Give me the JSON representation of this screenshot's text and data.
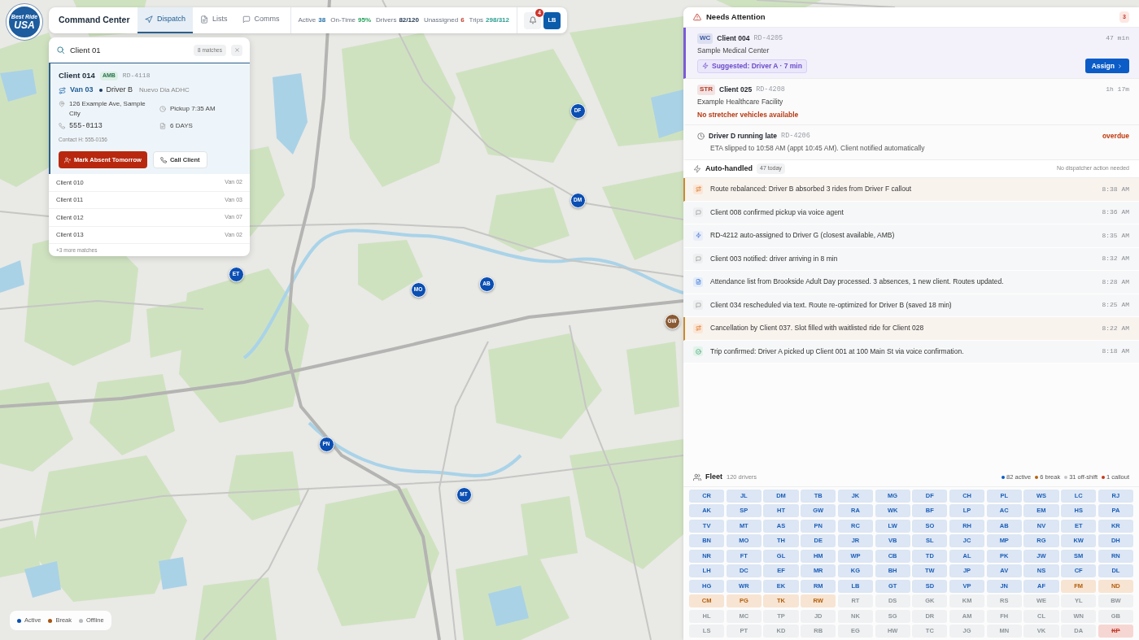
{
  "logo": {
    "line_1": "Best Ride",
    "line_2": "USA"
  },
  "header": {
    "title": "Command Center",
    "tabs": [
      {
        "label": "Dispatch",
        "kind": "navigation",
        "selected": true
      },
      {
        "label": "Lists",
        "kind": "document",
        "selected": false
      },
      {
        "label": "Comms",
        "kind": "chat",
        "selected": false
      }
    ],
    "stats": [
      {
        "label": "Active",
        "value": "38",
        "kind": "info"
      },
      {
        "label": "On-Time",
        "value": "95%",
        "kind": "good"
      },
      {
        "label": "Drivers",
        "value": "82/120",
        "kind": "neutral"
      },
      {
        "label": "Unassigned",
        "value": "6",
        "kind": "alert"
      },
      {
        "label": "Trips",
        "value": "298/312",
        "kind": "progress"
      }
    ],
    "notifications": {
      "count": "4"
    },
    "user": {
      "initials": "LB"
    }
  },
  "search": {
    "value": "Client 01",
    "match_count": "8 matches",
    "selected_result": {
      "client": "Client 014",
      "tag": "AMB",
      "ride_id": "RD-4118",
      "vehicle": "Van 03",
      "driver": "Driver B",
      "program": "Nuevo Dia ADHC",
      "address": "126 Example Ave, Sample City",
      "pickup": "Pickup 7:35 AM",
      "phone": "555-0113",
      "schedule": "6 DAYS",
      "contact": "Contact H: 555-0156",
      "actions": [
        {
          "label": "Mark Absent Tomorrow",
          "kind": "danger"
        },
        {
          "label": "Call Client",
          "kind": "call"
        }
      ]
    },
    "results": [
      {
        "client": "Client 010",
        "vehicle": "Van 02"
      },
      {
        "client": "Client 011",
        "vehicle": "Van 03"
      },
      {
        "client": "Client 012",
        "vehicle": "Van 07"
      },
      {
        "client": "Client 013",
        "vehicle": "Van 02"
      }
    ],
    "more": "+3 more matches"
  },
  "map": {
    "markers": [
      {
        "initials": "DF",
        "kind": "active"
      },
      {
        "initials": "DM",
        "kind": "active"
      },
      {
        "initials": "ET",
        "kind": "active"
      },
      {
        "initials": "AB",
        "kind": "active"
      },
      {
        "initials": "MO",
        "kind": "active"
      },
      {
        "initials": "GW",
        "kind": "break"
      },
      {
        "initials": "PN",
        "kind": "active"
      },
      {
        "initials": "MT",
        "kind": "active"
      }
    ],
    "legend": [
      {
        "label": "Active",
        "color": "#0b4fb3"
      },
      {
        "label": "Break",
        "color": "#a9530f"
      },
      {
        "label": "Offline",
        "color": "#b9bcbf"
      }
    ]
  },
  "needs_attention": {
    "title": "Needs Attention",
    "count": "3",
    "items": [
      {
        "kind": "ride",
        "selected": true,
        "tag": "WC",
        "color": "#3a57a0",
        "client": "Client 004",
        "ride_id": "RD-4205",
        "age": "47 min",
        "facility": "Sample Medical Center",
        "suggestion": "Suggested: Driver A · 7 min",
        "action": "Assign"
      },
      {
        "kind": "ride",
        "selected": false,
        "tag": "STR",
        "color": "#b53a2a",
        "client": "Client 025",
        "ride_id": "RD-4208",
        "age": "1h 17m",
        "facility": "Example Healthcare Facility",
        "warning": "No stretcher vehicles available"
      },
      {
        "kind": "late",
        "selected": false,
        "title": "Driver D running late",
        "ride_id": "RD-4206",
        "status": "overdue",
        "detail": "ETA slipped to 10:58 AM (appt 10:45 AM). Client notified automatically"
      }
    ]
  },
  "auto_handled": {
    "title": "Auto-handled",
    "count": "47 today",
    "note": "No dispatcher action needed",
    "events": [
      {
        "kind": "rebalance",
        "text": "Route rebalanced: Driver B absorbed 3 rides from Driver F callout",
        "time": "8:38 AM"
      },
      {
        "kind": "message",
        "text": "Client 008 confirmed pickup via voice agent",
        "time": "8:36 AM"
      },
      {
        "kind": "auto_assign",
        "text": "RD-4212 auto-assigned to Driver G (closest available, AMB)",
        "time": "8:35 AM"
      },
      {
        "kind": "message",
        "text": "Client 003 notified: driver arriving in 8 min",
        "time": "8:32 AM"
      },
      {
        "kind": "document",
        "text": "Attendance list from Brookside Adult Day processed. 3 absences, 1 new client. Routes updated.",
        "time": "8:28 AM"
      },
      {
        "kind": "message",
        "text": "Client 034 rescheduled via text. Route re-optimized for Driver B (saved 18 min)",
        "time": "8:25 AM"
      },
      {
        "kind": "rebalance",
        "text": "Cancellation by Client 037. Slot filled with waitlisted ride for Client 028",
        "time": "8:22 AM"
      },
      {
        "kind": "confirmed",
        "text": "Trip confirmed: Driver A picked up Client 001 at 100 Main St via voice confirmation.",
        "time": "8:18 AM"
      }
    ]
  },
  "fleet": {
    "title": "Fleet",
    "count": "120 drivers",
    "summary": [
      {
        "label": "82 active",
        "color": "#0b5cc7"
      },
      {
        "label": "6 break",
        "color": "#b8600f"
      },
      {
        "label": "31 off-shift",
        "color": "#c2c5c8"
      },
      {
        "label": "1 callout",
        "color": "#c43a1c"
      }
    ],
    "drivers": [
      {
        "initials": "CR",
        "kind": "active"
      },
      {
        "initials": "JL",
        "kind": "active"
      },
      {
        "initials": "DM",
        "kind": "active"
      },
      {
        "initials": "TB",
        "kind": "active"
      },
      {
        "initials": "JK",
        "kind": "active"
      },
      {
        "initials": "MG",
        "kind": "active"
      },
      {
        "initials": "DF",
        "kind": "active"
      },
      {
        "initials": "CH",
        "kind": "active"
      },
      {
        "initials": "PL",
        "kind": "active"
      },
      {
        "initials": "WS",
        "kind": "active"
      },
      {
        "initials": "LC",
        "kind": "active"
      },
      {
        "initials": "RJ",
        "kind": "active"
      },
      {
        "initials": "AK",
        "kind": "active"
      },
      {
        "initials": "SP",
        "kind": "active"
      },
      {
        "initials": "HT",
        "kind": "active"
      },
      {
        "initials": "GW",
        "kind": "active"
      },
      {
        "initials": "RA",
        "kind": "active"
      },
      {
        "initials": "WK",
        "kind": "active"
      },
      {
        "initials": "BF",
        "kind": "active"
      },
      {
        "initials": "LP",
        "kind": "active"
      },
      {
        "initials": "AC",
        "kind": "active"
      },
      {
        "initials": "EM",
        "kind": "active"
      },
      {
        "initials": "HS",
        "kind": "active"
      },
      {
        "initials": "PA",
        "kind": "active"
      },
      {
        "initials": "TV",
        "kind": "active"
      },
      {
        "initials": "MT",
        "kind": "active"
      },
      {
        "initials": "AS",
        "kind": "active"
      },
      {
        "initials": "PN",
        "kind": "active"
      },
      {
        "initials": "RC",
        "kind": "active"
      },
      {
        "initials": "LW",
        "kind": "active"
      },
      {
        "initials": "SO",
        "kind": "active"
      },
      {
        "initials": "RH",
        "kind": "active"
      },
      {
        "initials": "AB",
        "kind": "active"
      },
      {
        "initials": "NV",
        "kind": "active"
      },
      {
        "initials": "ET",
        "kind": "active"
      },
      {
        "initials": "KR",
        "kind": "active"
      },
      {
        "initials": "BN",
        "kind": "active"
      },
      {
        "initials": "MO",
        "kind": "active"
      },
      {
        "initials": "TH",
        "kind": "active"
      },
      {
        "initials": "DE",
        "kind": "active"
      },
      {
        "initials": "JR",
        "kind": "active"
      },
      {
        "initials": "VB",
        "kind": "active"
      },
      {
        "initials": "SL",
        "kind": "active"
      },
      {
        "initials": "JC",
        "kind": "active"
      },
      {
        "initials": "MP",
        "kind": "active"
      },
      {
        "initials": "RG",
        "kind": "active"
      },
      {
        "initials": "KW",
        "kind": "active"
      },
      {
        "initials": "DH",
        "kind": "active"
      },
      {
        "initials": "NR",
        "kind": "active"
      },
      {
        "initials": "FT",
        "kind": "active"
      },
      {
        "initials": "GL",
        "kind": "active"
      },
      {
        "initials": "HM",
        "kind": "active"
      },
      {
        "initials": "WP",
        "kind": "active"
      },
      {
        "initials": "CB",
        "kind": "active"
      },
      {
        "initials": "TD",
        "kind": "active"
      },
      {
        "initials": "AL",
        "kind": "active"
      },
      {
        "initials": "PK",
        "kind": "active"
      },
      {
        "initials": "JW",
        "kind": "active"
      },
      {
        "initials": "SM",
        "kind": "active"
      },
      {
        "initials": "RN",
        "kind": "active"
      },
      {
        "initials": "LH",
        "kind": "active"
      },
      {
        "initials": "DC",
        "kind": "active"
      },
      {
        "initials": "EF",
        "kind": "active"
      },
      {
        "initials": "MR",
        "kind": "active"
      },
      {
        "initials": "KG",
        "kind": "active"
      },
      {
        "initials": "BH",
        "kind": "active"
      },
      {
        "initials": "TW",
        "kind": "active"
      },
      {
        "initials": "JP",
        "kind": "active"
      },
      {
        "initials": "AV",
        "kind": "active"
      },
      {
        "initials": "NS",
        "kind": "active"
      },
      {
        "initials": "CF",
        "kind": "active"
      },
      {
        "initials": "DL",
        "kind": "active"
      },
      {
        "initials": "HG",
        "kind": "active"
      },
      {
        "initials": "WR",
        "kind": "active"
      },
      {
        "initials": "EK",
        "kind": "active"
      },
      {
        "initials": "RM",
        "kind": "active"
      },
      {
        "initials": "LB",
        "kind": "active"
      },
      {
        "initials": "GT",
        "kind": "active"
      },
      {
        "initials": "SD",
        "kind": "active"
      },
      {
        "initials": "VP",
        "kind": "active"
      },
      {
        "initials": "JN",
        "kind": "active"
      },
      {
        "initials": "AF",
        "kind": "active"
      },
      {
        "initials": "FM",
        "kind": "break"
      },
      {
        "initials": "ND",
        "kind": "break"
      },
      {
        "initials": "CM",
        "kind": "break"
      },
      {
        "initials": "PG",
        "kind": "break"
      },
      {
        "initials": "TK",
        "kind": "break"
      },
      {
        "initials": "RW",
        "kind": "break"
      },
      {
        "initials": "RT",
        "kind": "off"
      },
      {
        "initials": "DS",
        "kind": "off"
      },
      {
        "initials": "GK",
        "kind": "off"
      },
      {
        "initials": "KM",
        "kind": "off"
      },
      {
        "initials": "RS",
        "kind": "off"
      },
      {
        "initials": "WE",
        "kind": "off"
      },
      {
        "initials": "YL",
        "kind": "off"
      },
      {
        "initials": "BW",
        "kind": "off"
      },
      {
        "initials": "HL",
        "kind": "off"
      },
      {
        "initials": "MC",
        "kind": "off"
      },
      {
        "initials": "TP",
        "kind": "off"
      },
      {
        "initials": "JD",
        "kind": "off"
      },
      {
        "initials": "NK",
        "kind": "off"
      },
      {
        "initials": "SG",
        "kind": "off"
      },
      {
        "initials": "DR",
        "kind": "off"
      },
      {
        "initials": "AM",
        "kind": "off"
      },
      {
        "initials": "FH",
        "kind": "off"
      },
      {
        "initials": "CL",
        "kind": "off"
      },
      {
        "initials": "WN",
        "kind": "off"
      },
      {
        "initials": "GB",
        "kind": "off"
      },
      {
        "initials": "LS",
        "kind": "off"
      },
      {
        "initials": "PT",
        "kind": "off"
      },
      {
        "initials": "KD",
        "kind": "off"
      },
      {
        "initials": "RB",
        "kind": "off"
      },
      {
        "initials": "EG",
        "kind": "off"
      },
      {
        "initials": "HW",
        "kind": "off"
      },
      {
        "initials": "TC",
        "kind": "off"
      },
      {
        "initials": "JG",
        "kind": "off"
      },
      {
        "initials": "MN",
        "kind": "off"
      },
      {
        "initials": "VK",
        "kind": "off"
      },
      {
        "initials": "DA",
        "kind": "off"
      },
      {
        "initials": "KP",
        "kind": "callout"
      }
    ]
  }
}
